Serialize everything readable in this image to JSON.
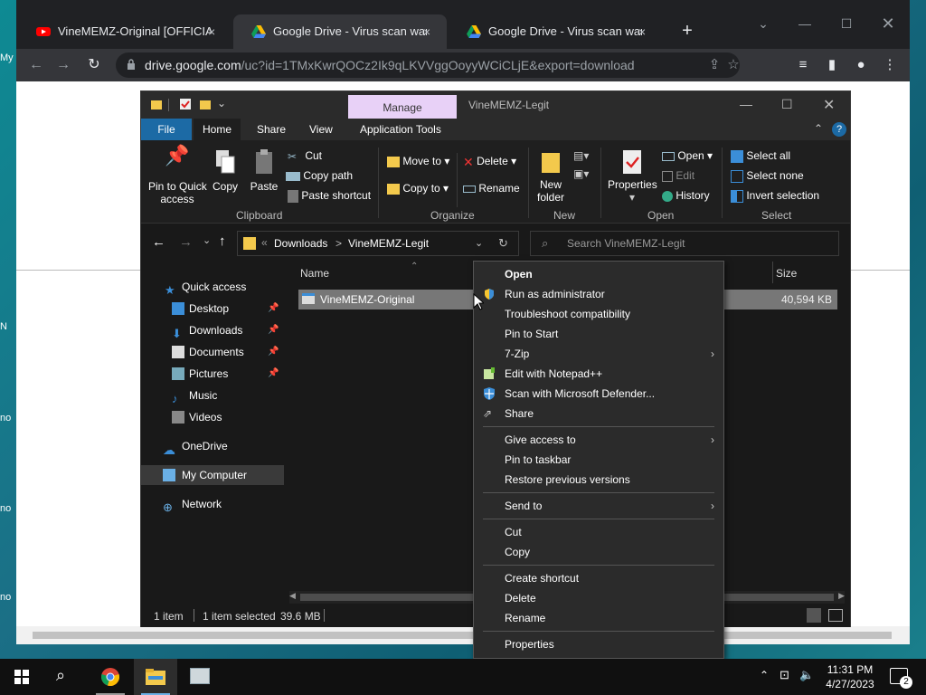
{
  "desktop": {
    "icon_fragments": [
      "My",
      "N",
      "no",
      "no",
      "no"
    ]
  },
  "chrome": {
    "tabs": [
      {
        "title": "VineMEMZ-Original [OFFICIAL] F",
        "icon": "youtube-icon",
        "close": "×",
        "active": false
      },
      {
        "title": "Google Drive - Virus scan warnin",
        "icon": "google-drive-icon",
        "close": "×",
        "active": true
      },
      {
        "title": "Google Drive - Virus scan warnin",
        "icon": "google-drive-icon",
        "close": "×",
        "active": false
      }
    ],
    "new_tab": "+",
    "url_host": "drive.google.com",
    "url_path": "/uc?id=1TMxKwrQOCz2Ik9qLKVVggOoyyWCiCLjE&export=download"
  },
  "explorer": {
    "title": "VineMEMZ-Legit",
    "manage_tab": "Manage",
    "ribbon_tabs": [
      "File",
      "Home",
      "Share",
      "View",
      "Application Tools"
    ],
    "clipboard": {
      "pin_label": "Pin to Quick access",
      "pin_line1": "Pin to Quick",
      "pin_line2": "access",
      "copy": "Copy",
      "paste": "Paste",
      "cut": "Cut",
      "copy_path": "Copy path",
      "paste_shortcut": "Paste shortcut",
      "group": "Clipboard"
    },
    "organize": {
      "move_to": "Move to",
      "copy_to": "Copy to",
      "delete": "Delete",
      "rename": "Rename",
      "group": "Organize"
    },
    "new": {
      "new_folder_line1": "New",
      "new_folder_line2": "folder",
      "group": "New"
    },
    "open": {
      "properties": "Properties",
      "open": "Open",
      "edit": "Edit",
      "history": "History",
      "group": "Open"
    },
    "select": {
      "select_all": "Select all",
      "select_none": "Select none",
      "invert": "Invert selection",
      "group": "Select"
    },
    "breadcrumb": [
      "Downloads",
      "VineMEMZ-Legit"
    ],
    "breadcrumb_prefix": "«",
    "breadcrumb_sep": ">",
    "search_placeholder": "Search VineMEMZ-Legit",
    "nav": [
      {
        "label": "Quick access",
        "icon": "star-icon",
        "pinned": false
      },
      {
        "label": "Desktop",
        "icon": "desktop-folder-icon",
        "pinned": true
      },
      {
        "label": "Downloads",
        "icon": "download-arrow-icon",
        "pinned": true
      },
      {
        "label": "Documents",
        "icon": "documents-icon",
        "pinned": true
      },
      {
        "label": "Pictures",
        "icon": "pictures-icon",
        "pinned": true
      },
      {
        "label": "Music",
        "icon": "music-note-icon",
        "pinned": false
      },
      {
        "label": "Videos",
        "icon": "videos-icon",
        "pinned": false
      },
      {
        "label": "OneDrive",
        "icon": "cloud-icon",
        "pinned": false
      },
      {
        "label": "My Computer",
        "icon": "computer-icon",
        "pinned": false
      },
      {
        "label": "Network",
        "icon": "network-icon",
        "pinned": false
      }
    ],
    "columns": {
      "name": "Name",
      "size": "Size"
    },
    "files": [
      {
        "name": "VineMEMZ-Original",
        "size": "40,594 KB"
      }
    ],
    "status": {
      "count": "1 item",
      "selected": "1 item selected",
      "selected_size": "39.6 MB"
    }
  },
  "context_menu": {
    "items": [
      {
        "label": "Open",
        "bold": true
      },
      {
        "label": "Run as administrator",
        "icon": "uac-shield-icon"
      },
      {
        "label": "Troubleshoot compatibility"
      },
      {
        "label": "Pin to Start"
      },
      {
        "label": "7-Zip",
        "submenu": true
      },
      {
        "label": "Edit with Notepad++",
        "icon": "notepad-plus-plus-icon"
      },
      {
        "label": "Scan with Microsoft Defender...",
        "icon": "defender-icon"
      },
      {
        "label": "Share",
        "icon": "share-icon"
      },
      {
        "label": "Give access to",
        "submenu": true
      },
      {
        "label": "Pin to taskbar"
      },
      {
        "label": "Restore previous versions"
      },
      {
        "label": "Send to",
        "submenu": true
      },
      {
        "label": "Cut"
      },
      {
        "label": "Copy"
      },
      {
        "label": "Create shortcut"
      },
      {
        "label": "Delete"
      },
      {
        "label": "Rename"
      },
      {
        "label": "Properties"
      }
    ],
    "submenu_arrow": "›"
  },
  "taskbar": {
    "time": "11:31 PM",
    "date": "4/27/2023",
    "notifications": "2"
  },
  "colors": {
    "explorer_bg": "#191919",
    "ribbon_file_tab": "#1c6aa5",
    "manage_tab": "#e8d1f7",
    "chrome_frame": "#202124",
    "selected_file": "#777777"
  }
}
